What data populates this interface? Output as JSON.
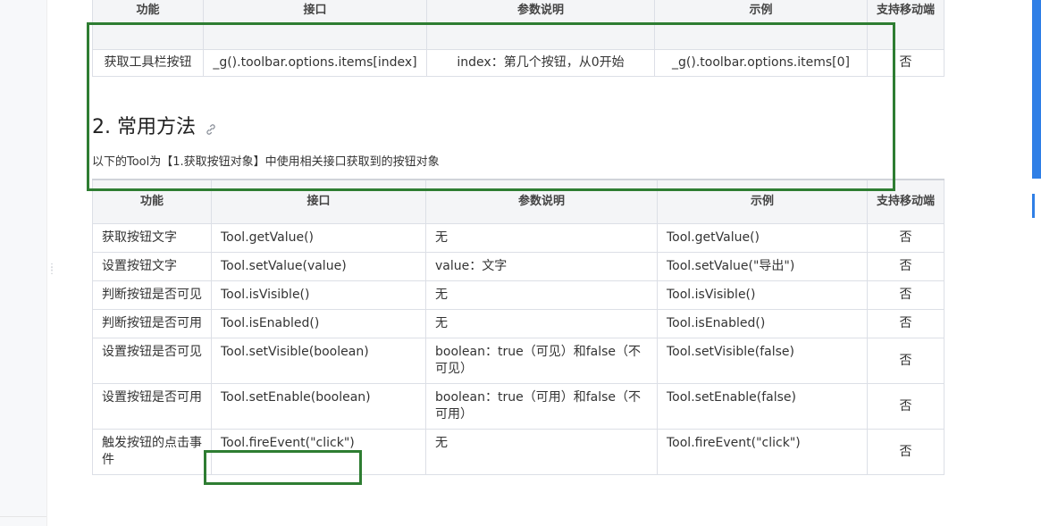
{
  "table1": {
    "headers": [
      "功能",
      "接口",
      "参数说明",
      "示例",
      "支持移动端"
    ],
    "rows": [
      [
        "获取工具栏按钮",
        "_g().toolbar.options.items[index]",
        "index：第几个按钮，从0开始",
        "_g().toolbar.options.items[0]",
        "否"
      ]
    ]
  },
  "section": {
    "heading": "2. 常用方法",
    "intro": "以下的Tool为【1.获取按钮对象】中使用相关接口获取到的按钮对象"
  },
  "table2": {
    "headers": [
      "功能",
      "接口",
      "参数说明",
      "示例",
      "支持移动端"
    ],
    "rows": [
      [
        "获取按钮文字",
        "Tool.getValue()",
        "无",
        "Tool.getValue()",
        "否"
      ],
      [
        "设置按钮文字",
        "Tool.setValue(value)",
        "value：文字",
        "Tool.setValue(\"导出\")",
        "否"
      ],
      [
        "判断按钮是否可见",
        "Tool.isVisible()",
        "无",
        "Tool.isVisible()",
        "否"
      ],
      [
        "判断按钮是否可用",
        "Tool.isEnabled()",
        "无",
        "Tool.isEnabled()",
        "否"
      ],
      [
        "设置按钮是否可见",
        "Tool.setVisible(boolean)",
        "boolean：true（可见）和false（不可见）",
        "Tool.setVisible(false)",
        "否"
      ],
      [
        "设置按钮是否可用",
        "Tool.setEnable(boolean)",
        "boolean：true（可用）和false（不可用）",
        "Tool.setEnable(false)",
        "否"
      ],
      [
        "触发按钮的点击事件",
        "Tool.fireEvent(\"click\")",
        "无",
        "Tool.fireEvent(\"click\")",
        "否"
      ]
    ]
  },
  "colors": {
    "highlight_box": "#2e7d32",
    "scroll_accent": "#2f7fe6",
    "header_bg": "#f4f5f7",
    "border": "#dcdfe6"
  },
  "icons": {
    "heading_anchor": "link-icon",
    "splitter": "drag-handle-icon"
  }
}
